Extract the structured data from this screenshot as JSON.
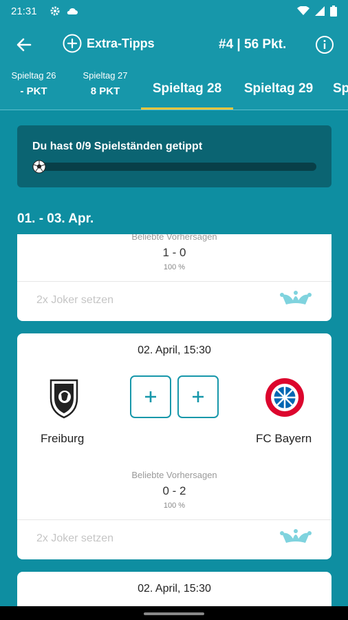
{
  "status": {
    "time": "21:31"
  },
  "appbar": {
    "extra_tipps": "Extra-Tipps",
    "rank": "#4 | 56 Pkt."
  },
  "tabs": [
    {
      "label": "Spieltag 26",
      "points": "- PKT"
    },
    {
      "label": "Spieltag 27",
      "points": "8 PKT"
    },
    {
      "label": "Spieltag 28"
    },
    {
      "label": "Spieltag 29"
    },
    {
      "label": "Sp"
    }
  ],
  "progress": {
    "text": "Du hast 0/9 Spielständen getippt",
    "fraction": 0
  },
  "date_range": "01. - 03. Apr.",
  "cards": [
    {
      "popular_label": "Beliebte Vorhersagen",
      "popular_score": "1 - 0",
      "popular_pct": "100 %",
      "joker": "2x Joker setzen"
    },
    {
      "date": "02. April, 15:30",
      "home": "Freiburg",
      "away": "FC Bayern",
      "popular_label": "Beliebte Vorhersagen",
      "popular_score": "0 - 2",
      "popular_pct": "100 %",
      "joker": "2x Joker setzen"
    },
    {
      "date": "02. April, 15:30"
    }
  ],
  "colors": {
    "teal": "#1797aa",
    "dark_panel": "#0b6472",
    "accent": "#f4c63f",
    "joker": "#7fd3de"
  },
  "icons": [
    "back-arrow-icon",
    "add-circle-icon",
    "info-icon",
    "gear-icon",
    "cloud-icon",
    "wifi-icon",
    "signal-icon",
    "battery-icon",
    "soccer-ball-icon",
    "jester-hat-icon",
    "plus-icon"
  ]
}
